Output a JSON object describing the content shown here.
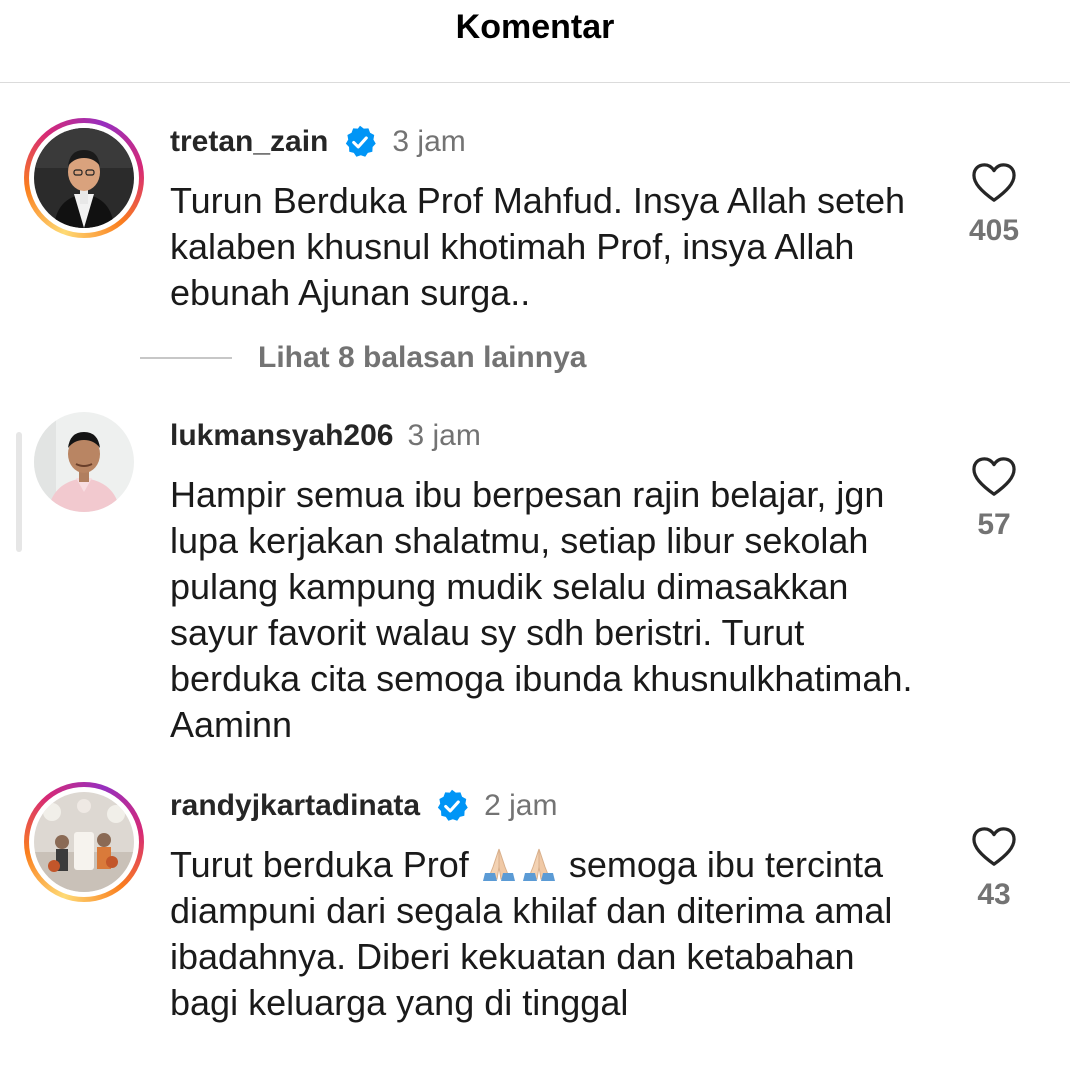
{
  "header": {
    "title": "Komentar"
  },
  "comments": [
    {
      "username": "tretan_zain",
      "verified": true,
      "time": "3 jam",
      "text": "Turun Berduka Prof Mahfud. Insya Allah seteh kalaben khusnul khotimah Prof, insya Allah ebunah Ajunan surga..",
      "likes": "405",
      "replies_label": "Lihat 8 balasan lainnya"
    },
    {
      "username": "lukmansyah206",
      "verified": false,
      "time": "3 jam",
      "text": "Hampir semua ibu berpesan rajin belajar, jgn lupa  kerjakan shalatmu, setiap libur sekolah pulang kampung mudik selalu dimasakkan sayur favorit walau sy sdh beristri.  Turut berduka cita semoga ibunda khusnulkhatimah. Aaminn",
      "likes": "57"
    },
    {
      "username": "randyjkartadinata",
      "verified": true,
      "time": "2 jam",
      "text_before": "Turut berduka Prof",
      "text_after": "semoga ibu tercinta diampuni dari segala khilaf dan diterima amal ibadahnya. Diberi kekuatan dan ketabahan bagi keluarga yang di tinggal",
      "likes": "43"
    }
  ],
  "colors": {
    "verified": "#0095f6",
    "muted": "#737373",
    "divider": "#dbdbdb"
  }
}
